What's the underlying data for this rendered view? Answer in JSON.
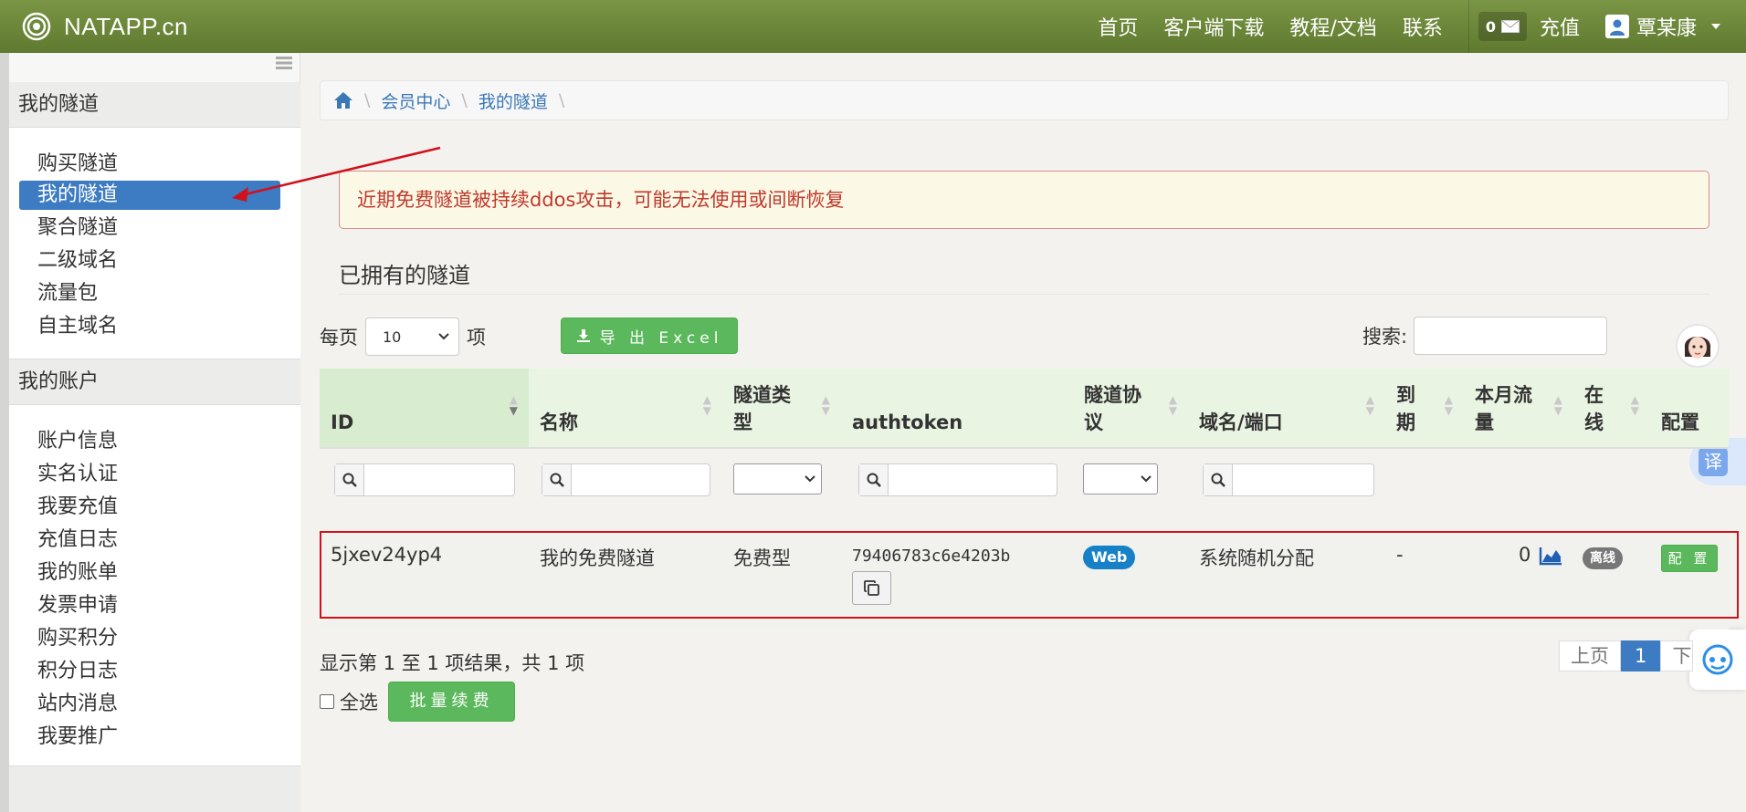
{
  "navbar": {
    "brand": "NATAPP.cn",
    "links": [
      "首页",
      "客户端下载",
      "教程/文档",
      "联系"
    ],
    "msg_count": "0",
    "recharge": "充值",
    "user": "覃某康"
  },
  "sidebar": {
    "group1_title": "我的隧道",
    "group1_items": [
      "购买隧道",
      "我的隧道",
      "聚合隧道",
      "二级域名",
      "流量包",
      "自主域名"
    ],
    "group2_title": "我的账户",
    "group2_items": [
      "账户信息",
      "实名认证",
      "我要充值",
      "充值日志",
      "我的账单",
      "发票申请",
      "购买积分",
      "积分日志",
      "站内消息",
      "我要推广"
    ],
    "active_item": "我的隧道"
  },
  "breadcrumb": [
    "会员中心",
    "我的隧道"
  ],
  "alert": "近期免费隧道被持续ddos攻击，可能无法使用或间断恢复",
  "section_title": "已拥有的隧道",
  "controls": {
    "perpage_prefix": "每页",
    "perpage_value": "10",
    "perpage_suffix": "项",
    "export_label": "导 出 Excel",
    "search_label": "搜索:"
  },
  "table": {
    "headers": [
      "ID",
      "名称",
      "隧道类型",
      "authtoken",
      "隧道协议",
      "域名/端口",
      "到期",
      "本月流量",
      "在线",
      "配置"
    ],
    "row": {
      "id": "5jxev24yp4",
      "name": "我的免费隧道",
      "type": "免费型",
      "authtoken": "79406783c6e4203b",
      "protocol": "Web",
      "domain": "系统随机分配",
      "expire": "-",
      "traffic": "0",
      "online": "离线",
      "config": "配 置"
    }
  },
  "footer": {
    "summary": "显示第 1 至 1 项结果，共 1 项",
    "select_all": "全选",
    "renew": "批量续费",
    "prev": "上页",
    "page": "1",
    "next": "下页"
  },
  "widgets": {
    "translate": "译"
  },
  "colors": {
    "navbar": "#6b8638",
    "active": "#3d7bc2",
    "success": "#5cb85c",
    "alert_text": "#c0392b",
    "annotation_red": "#d0111b"
  }
}
